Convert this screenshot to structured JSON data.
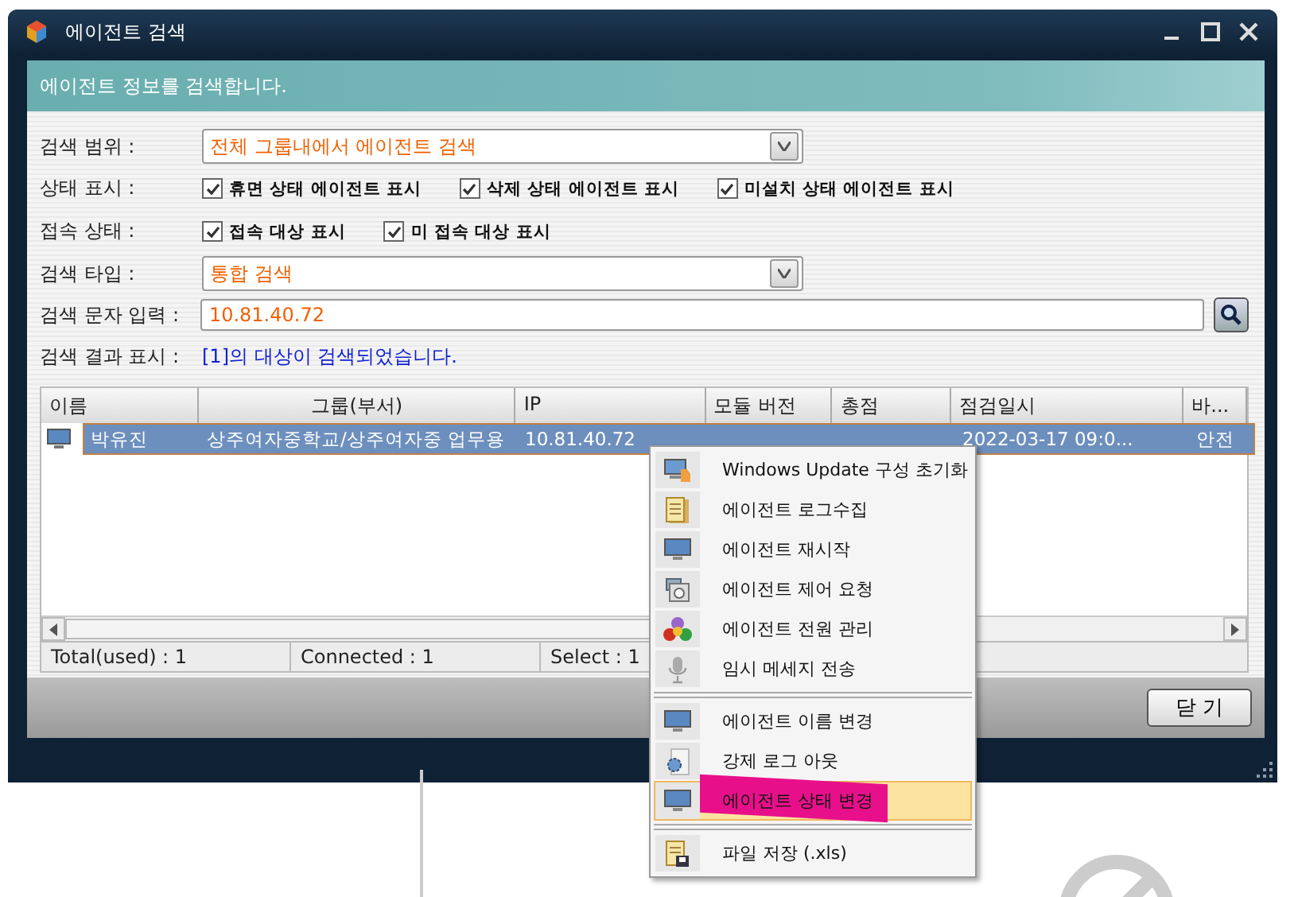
{
  "window": {
    "title": "에이전트 검색"
  },
  "header": {
    "text": "에이전트 정보를 검색합니다."
  },
  "form": {
    "scope": {
      "label": "검색 범위 :",
      "value": "전체 그룹내에서 에이전트 검색"
    },
    "status": {
      "label": "상태 표시 :",
      "options": [
        {
          "label": "휴면 상태 에이전트 표시",
          "checked": true
        },
        {
          "label": "삭제 상태 에이전트 표시",
          "checked": true
        },
        {
          "label": "미설치 상태 에이전트 표시",
          "checked": true
        }
      ]
    },
    "connection": {
      "label": "접속 상태 :",
      "options": [
        {
          "label": "접속 대상 표시",
          "checked": true
        },
        {
          "label": "미 접속 대상 표시",
          "checked": true
        }
      ]
    },
    "type": {
      "label": "검색 타입 :",
      "value": "통합 검색"
    },
    "query": {
      "label": "검색 문자 입력 :",
      "value": "10.81.40.72"
    },
    "result": {
      "label": "검색 결과 표시 :",
      "text": "[1]의 대상이 검색되었습니다."
    }
  },
  "table": {
    "columns": [
      "이름",
      "그룹(부서)",
      "IP",
      "모듈 버전",
      "총점",
      "점검일시",
      "바..."
    ],
    "rows": [
      {
        "selected": true,
        "cells": [
          "박유진",
          "상주여자중학교/상주여자중 업무용",
          "10.81.40.72",
          "",
          "",
          "2022-03-17 09:0...",
          "안전"
        ]
      }
    ],
    "status_bar": [
      "Total(used) : 1",
      "Connected : 1",
      "Select : 1"
    ]
  },
  "close_button": "닫 기",
  "context_menu": {
    "groups": [
      [
        {
          "label": "Windows Update 구성 초기화",
          "selected": false
        },
        {
          "label": "에이전트 로그수집",
          "selected": false
        },
        {
          "label": "에이전트 재시작",
          "selected": false
        },
        {
          "label": "에이전트 제어 요청",
          "selected": false
        },
        {
          "label": "에이전트 전원 관리",
          "selected": false
        },
        {
          "label": "임시 메세지 전송",
          "selected": false
        }
      ],
      [
        {
          "label": "에이전트 이름 변경",
          "selected": false
        },
        {
          "label": "강제 로그 아웃",
          "selected": false
        },
        {
          "label": "에이전트 상태 변경",
          "selected": true
        }
      ],
      [
        {
          "label": "파일 저장 (.xls)",
          "selected": false
        }
      ]
    ]
  }
}
